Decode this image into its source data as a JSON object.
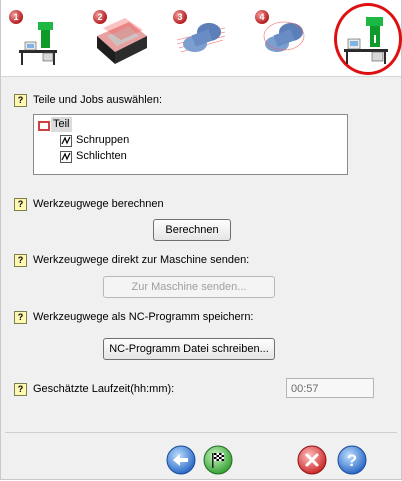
{
  "steps": [
    {
      "number": "1",
      "icon": "machine-setup-icon"
    },
    {
      "number": "2",
      "icon": "stock-part-icon"
    },
    {
      "number": "3",
      "icon": "part-blue-icon"
    },
    {
      "number": "4",
      "icon": "part-finished-icon"
    },
    {
      "number": "",
      "icon": "machine-output-icon",
      "active": true
    }
  ],
  "sections": {
    "select_parts": "Teile und Jobs auswählen:",
    "compute_toolpaths": "Werkzeugwege berechnen",
    "send_to_machine": "Werkzeugwege direkt zur Maschine senden:",
    "save_nc": "Werkzeugwege als NC-Programm speichern:",
    "runtime_label": "Geschätzte Laufzeit(hh:mm):"
  },
  "tree": {
    "root": "Teil",
    "children": [
      "Schruppen",
      "Schlichten"
    ]
  },
  "buttons": {
    "compute": "Berechnen",
    "send": "Zur Maschine senden...",
    "write_nc": "NC-Programm Datei schreiben..."
  },
  "runtime_value": "00:57",
  "help_glyph": "?",
  "colors": {
    "active_ring": "#e01010",
    "help_icon_bg": "#fff8b0",
    "panel_bg": "#f0f0f0"
  },
  "footer": {
    "back_icon": "back-arrow-icon",
    "finish_icon": "checkered-flag-icon",
    "cancel_icon": "close-icon",
    "help_icon": "help-icon"
  }
}
